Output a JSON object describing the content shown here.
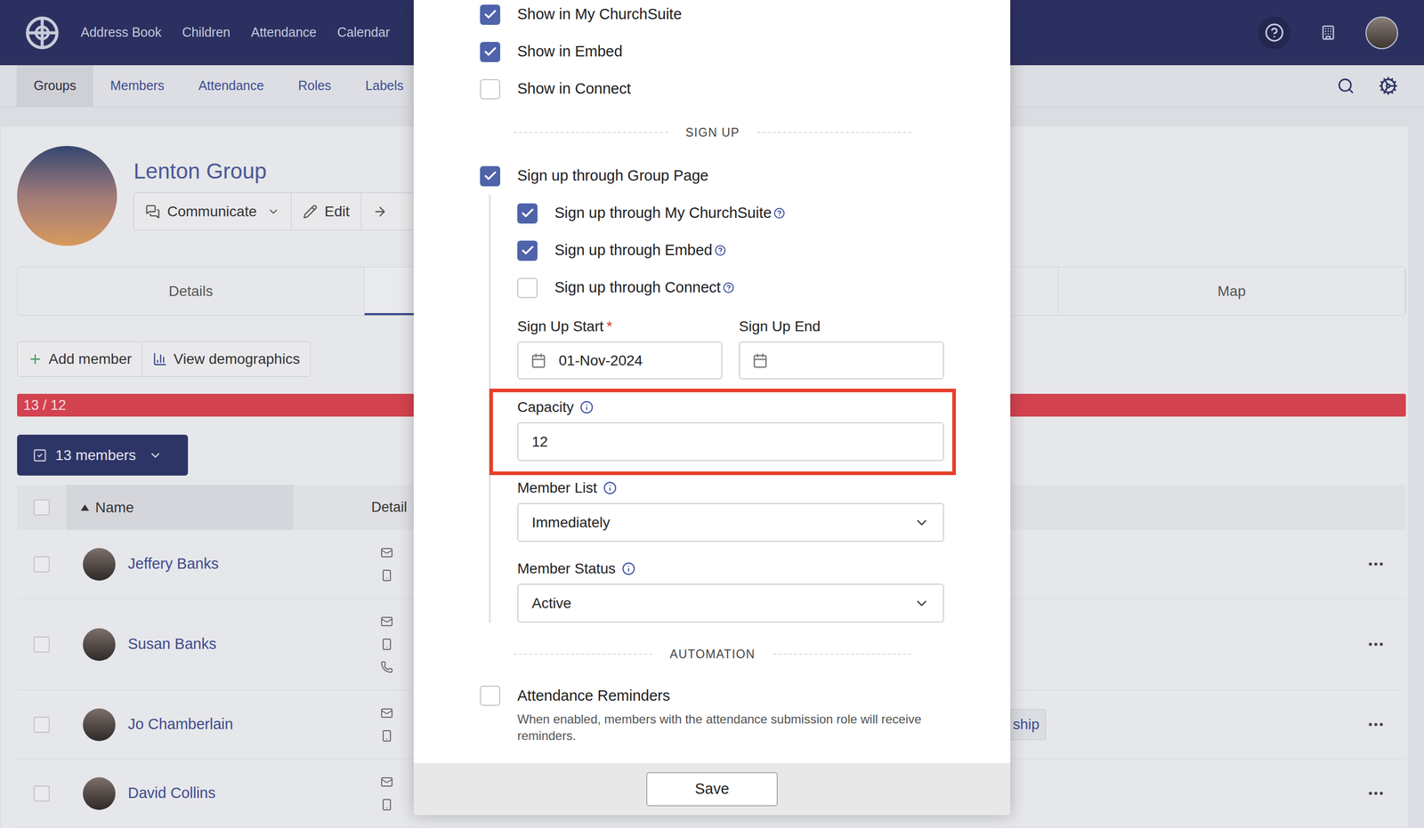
{
  "top_nav": {
    "items": [
      "Address Book",
      "Children",
      "Attendance",
      "Calendar"
    ]
  },
  "sub_nav": {
    "items": [
      {
        "label": "Groups",
        "selected": true
      },
      {
        "label": "Members",
        "selected": false
      },
      {
        "label": "Attendance",
        "selected": false
      },
      {
        "label": "Roles",
        "selected": false
      },
      {
        "label": "Labels",
        "selected": false
      }
    ]
  },
  "group": {
    "name": "Lenton Group",
    "actions": [
      "Communicate",
      "Edit"
    ]
  },
  "tabs": [
    {
      "label": "Details",
      "selected": false
    },
    {
      "label": "",
      "selected": true
    },
    {
      "label": "",
      "selected": false
    },
    {
      "label": "Map",
      "selected": false
    }
  ],
  "member_actions": [
    "Add member",
    "View demographics"
  ],
  "capacity_bar": {
    "reading": "13 / 12",
    "level": 1
  },
  "selection_button": {
    "label": "13 members"
  },
  "table": {
    "columns": [
      {
        "label": "Name",
        "sorted": "ascending"
      },
      {
        "label": "Detail",
        "sorted": "none"
      }
    ],
    "rows": [
      {
        "name": "Jeffery Banks",
        "checked": false,
        "contacts": [
          {
            "kind": "email"
          },
          {
            "kind": "mobile"
          }
        ],
        "tags": []
      },
      {
        "name": "Susan Banks",
        "checked": false,
        "contacts": [
          {
            "kind": "email"
          },
          {
            "kind": "mobile"
          },
          {
            "kind": "phone"
          }
        ],
        "tags": []
      },
      {
        "name": "Jo Chamberlain",
        "checked": false,
        "contacts": [
          {
            "kind": "email"
          },
          {
            "kind": "mobile"
          }
        ],
        "tags": [
          "ship"
        ]
      },
      {
        "name": "David Collins",
        "checked": false,
        "contacts": [
          {
            "kind": "email"
          },
          {
            "kind": "mobile"
          }
        ],
        "tags": []
      }
    ]
  },
  "dialog": {
    "visibility": [
      {
        "label": "Show in My ChurchSuite",
        "checked": true
      },
      {
        "label": "Show in Embed",
        "checked": true
      },
      {
        "label": "Show in Connect",
        "checked": false
      }
    ],
    "sign_up_section": "SIGN UP",
    "sign_up": {
      "label": "Sign up through Group Page",
      "checked": true
    },
    "sign_up_channels": [
      {
        "label": "Sign up through My ChurchSuite",
        "checked": true
      },
      {
        "label": "Sign up through Embed",
        "checked": true
      },
      {
        "label": "Sign up through Connect",
        "checked": false
      }
    ],
    "required_mark": "*",
    "dates": [
      {
        "label": "Sign Up Start",
        "required": true,
        "value": "01-Nov-2024"
      },
      {
        "label": "Sign Up End",
        "required": false,
        "value": ""
      }
    ],
    "capacity": {
      "label": "Capacity",
      "value": "12",
      "highlighted": true
    },
    "member_list": {
      "label": "Member List",
      "value": "Immediately"
    },
    "member_status": {
      "label": "Member Status",
      "value": "Active"
    },
    "automation_section": "AUTOMATION",
    "reminders": {
      "label": "Attendance Reminders",
      "checked": false,
      "description": "When enabled, members with the attendance submission role will receive reminders."
    },
    "save_button": "Save"
  }
}
